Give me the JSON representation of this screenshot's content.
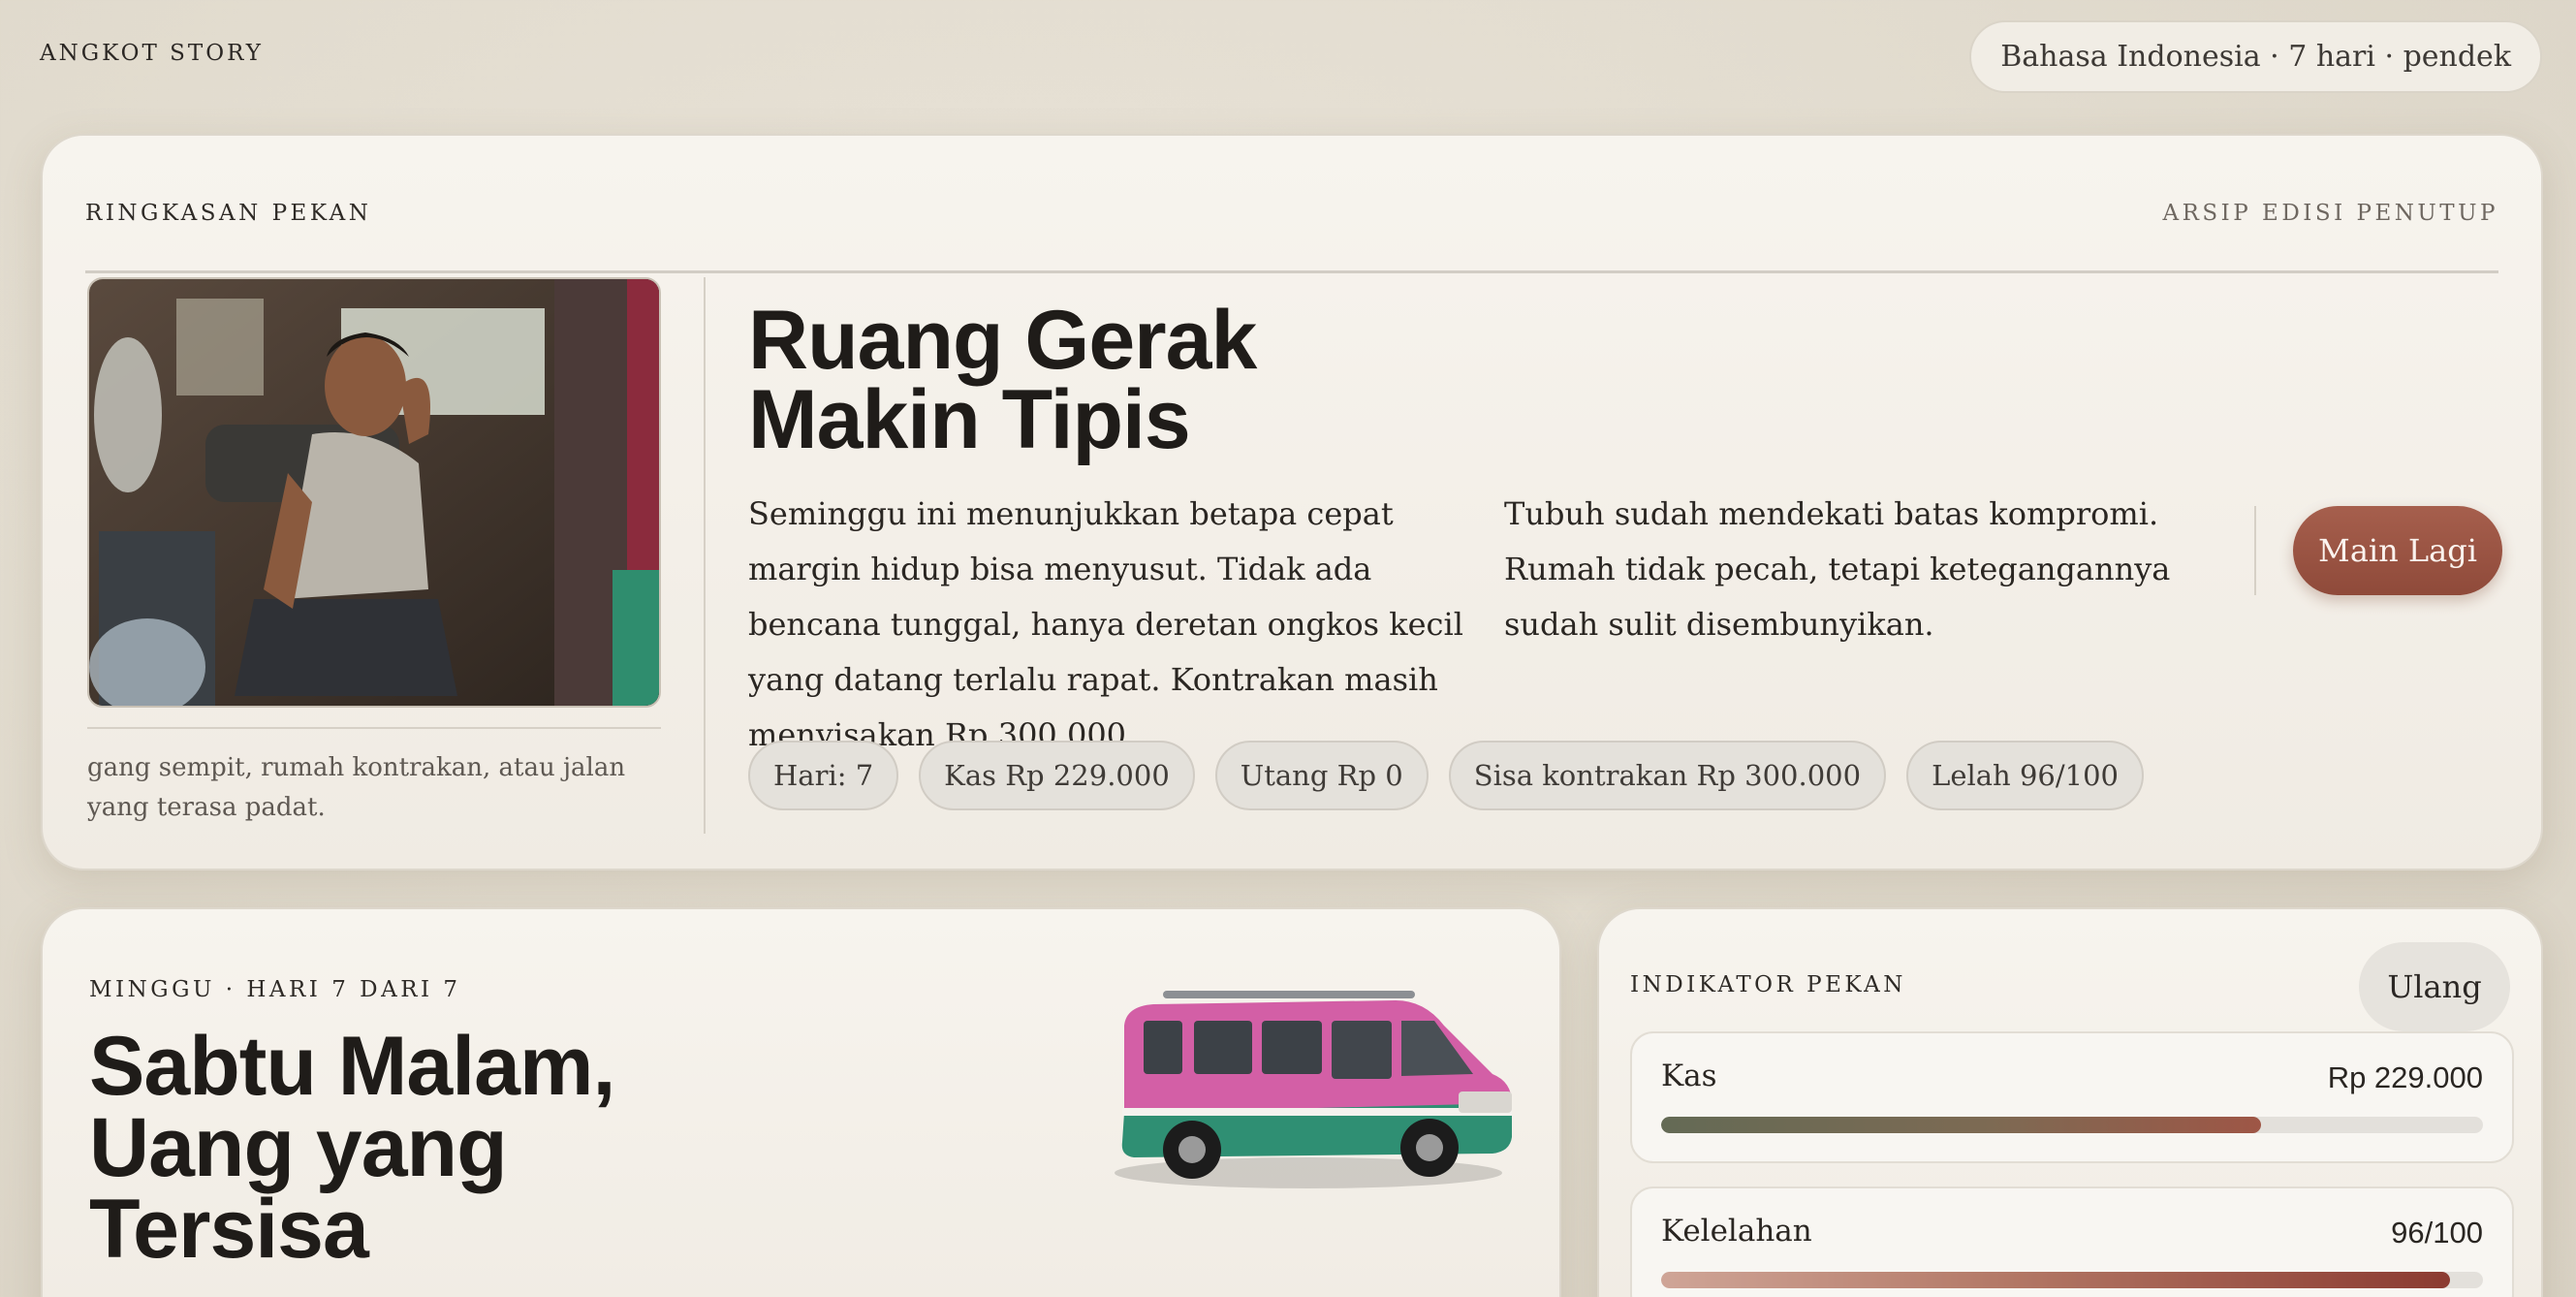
{
  "header": {
    "brand": "ANGKOT STORY",
    "settings_pill": "Bahasa Indonesia · 7 hari · pendek"
  },
  "summary": {
    "eyebrow_left": "RINGKASAN PEKAN",
    "eyebrow_right": "ARSIP EDISI PENUTUP",
    "photo_caption": "gang sempit, rumah kontrakan, atau jalan yang terasa padat.",
    "headline_line1": "Ruang Gerak",
    "headline_line2": "Makin Tipis",
    "paragraph_1": "Seminggu ini menunjukkan betapa cepat margin hidup bisa menyusut. Tidak ada bencana tunggal, hanya deretan ongkos kecil yang datang terlalu rapat. Kontrakan masih menyisakan Rp 300.000.",
    "paragraph_2": "Tubuh sudah mendekati batas kompromi. Rumah tidak pecah, tetapi ketegangannya sudah sulit disembunyikan.",
    "play_again_label": "Main Lagi",
    "stats": [
      "Hari: 7",
      "Kas Rp 229.000",
      "Utang Rp 0",
      "Sisa kontrakan Rp 300.000",
      "Lelah 96/100"
    ]
  },
  "week": {
    "eyebrow": "MINGGU · HARI 7 DARI 7",
    "title_line1": "Sabtu Malam,",
    "title_line2": "Uang yang",
    "title_line3": "Tersisa"
  },
  "indicators": {
    "eyebrow": "INDIKATOR PEKAN",
    "reset_label": "Ulang",
    "metrics": [
      {
        "label": "Kas",
        "value": "Rp 229.000",
        "fill_fraction": 0.73
      },
      {
        "label": "Kelelahan",
        "value": "96/100",
        "fill_fraction": 0.96
      }
    ]
  },
  "colors": {
    "accent_button": "#9a5342",
    "page_background": "#e2dccf",
    "card_background": "#f5f1ea"
  },
  "icons": {
    "hero_photo": "tired-driver-photo",
    "van_image": "angkot-van-illustration"
  }
}
